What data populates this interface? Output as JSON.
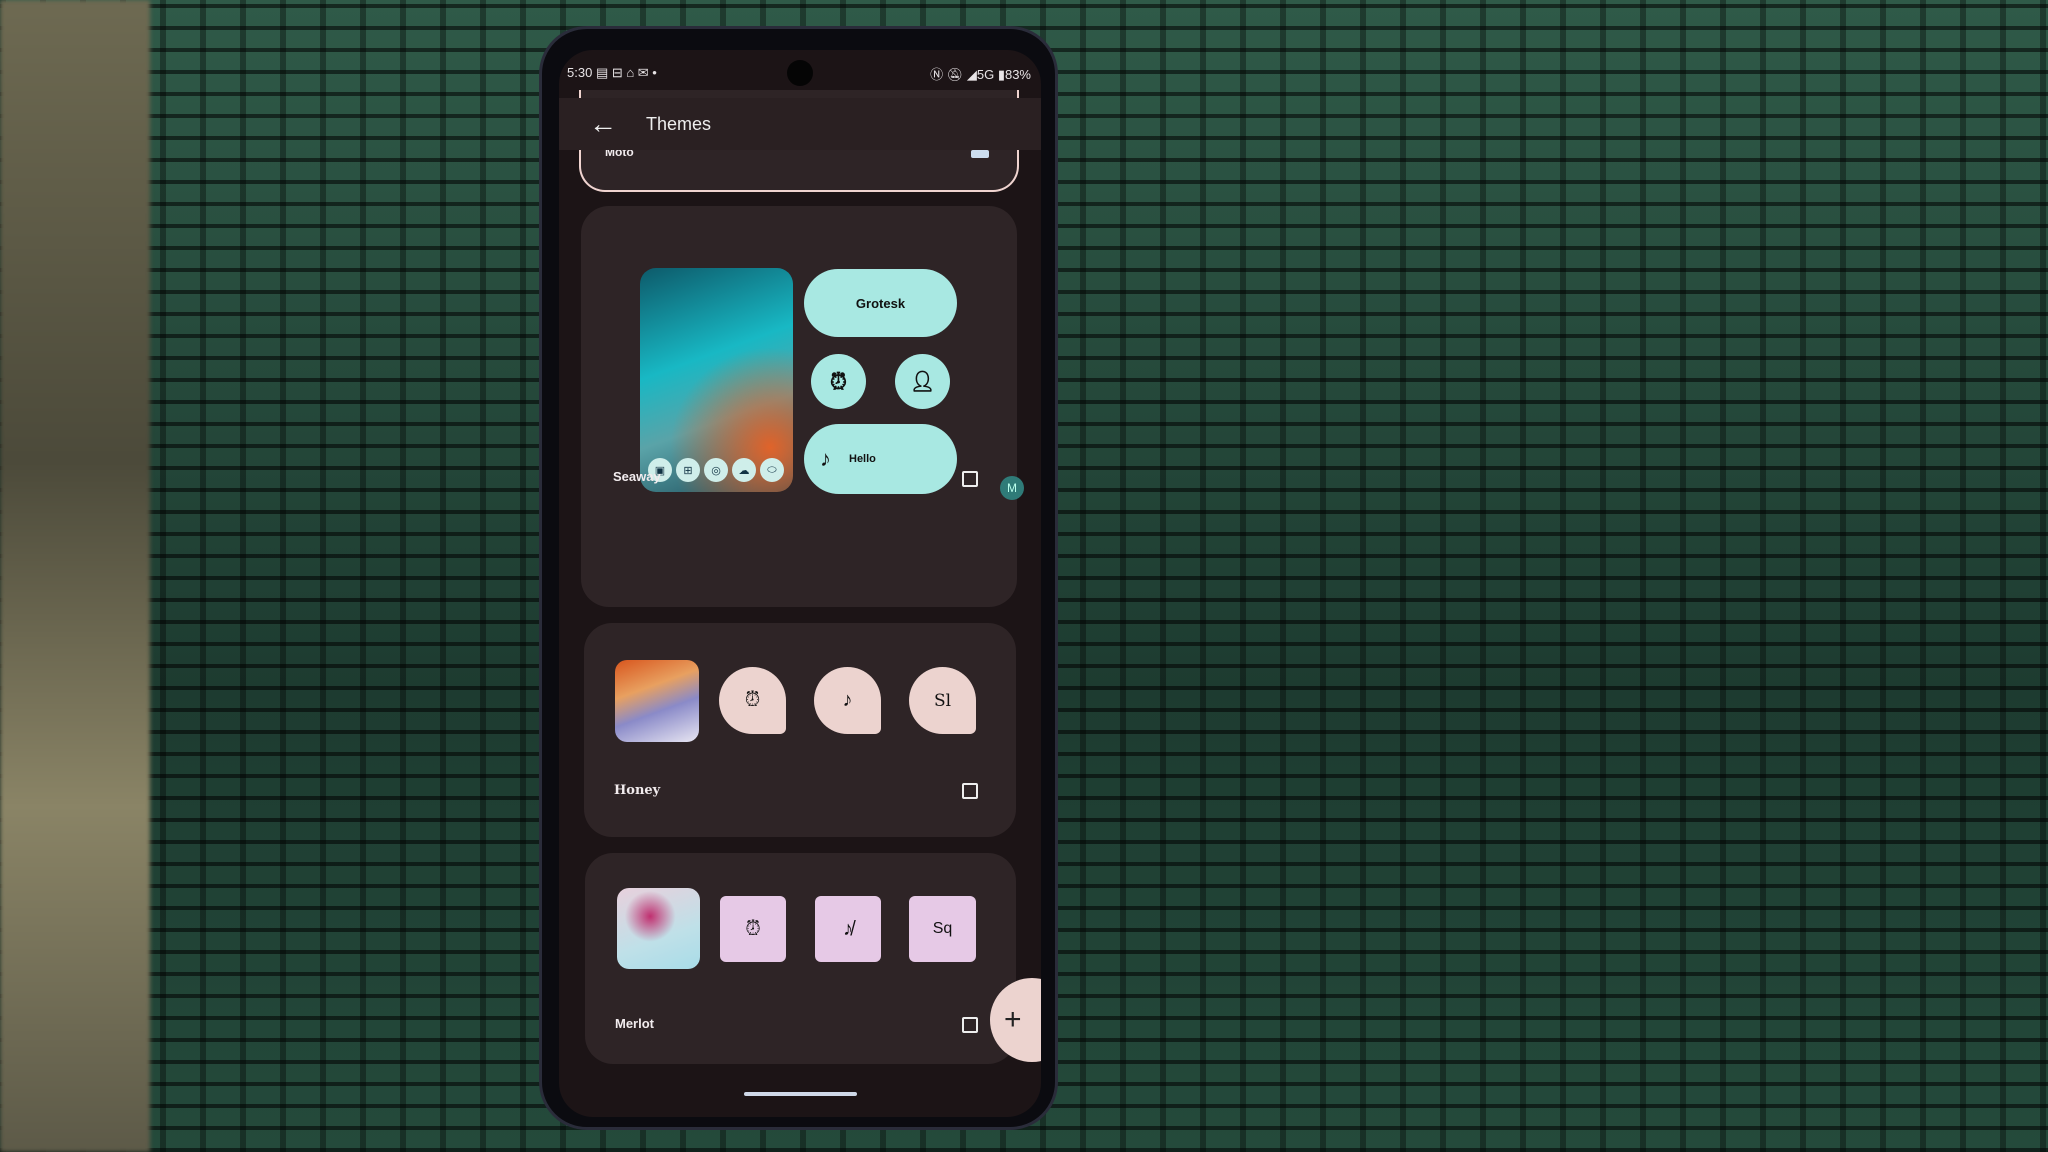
{
  "status_bar": {
    "time": "5:30",
    "network": "5G",
    "battery": "83%",
    "icons": [
      "news-icon",
      "car-icon",
      "home-icon",
      "mail-icon",
      "dot-icon",
      "nfc-icon",
      "bell-off-icon",
      "signal-icon",
      "battery-icon"
    ]
  },
  "app_bar": {
    "title": "Themes",
    "back_icon": "arrow-left-icon"
  },
  "partial_card": {
    "label": "Moto"
  },
  "themes": [
    {
      "name": "Seaway",
      "font_sample": "Grotesk",
      "music_label": "Hello",
      "accent": "#a8e8e2",
      "selected": false
    },
    {
      "name": "Honey",
      "font_sample": "Sl",
      "accent": "#ecd3cf",
      "selected": false
    },
    {
      "name": "Merlot",
      "font_sample": "Sq",
      "accent": "#e6c9e6",
      "selected": false
    }
  ],
  "fab": {
    "icon": "plus-icon"
  }
}
